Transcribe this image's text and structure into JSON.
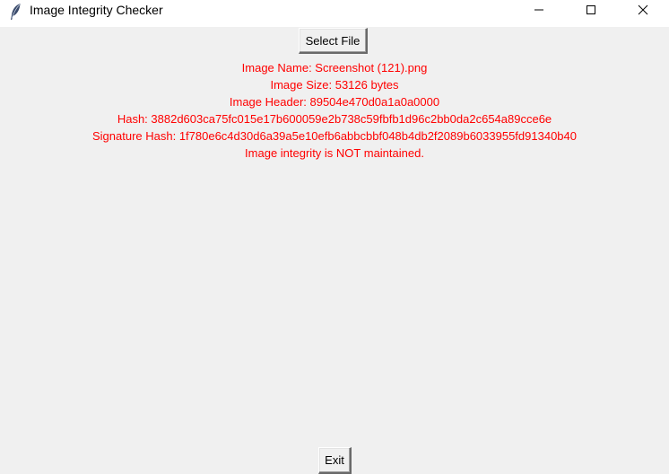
{
  "window": {
    "title": "Image Integrity Checker",
    "icon": "feather-icon",
    "controls": {
      "minimize_icon": "minimize-icon",
      "maximize_icon": "maximize-icon",
      "close_icon": "close-icon"
    }
  },
  "toolbar": {
    "select_file_label": "Select File"
  },
  "info": {
    "image_name": "Image Name: Screenshot (121).png",
    "image_size": "Image Size: 53126 bytes",
    "image_header": "Image Header: 89504e470d0a1a0a0000",
    "hash": "Hash: 3882d603ca75fc015e17b600059e2b738c59fbfb1d96c2bb0da2c654a89cce6e",
    "signature_hash": "Signature Hash: 1f780e6c4d30d6a39a5e10efb6abbcbbf048b4db2f2089b6033955fd91340b40",
    "status": "Image integrity is NOT maintained.",
    "text_color": "#ff0000"
  },
  "footer": {
    "exit_label": "Exit"
  },
  "colors": {
    "background": "#f0f0f0",
    "titlebar": "#ffffff"
  }
}
